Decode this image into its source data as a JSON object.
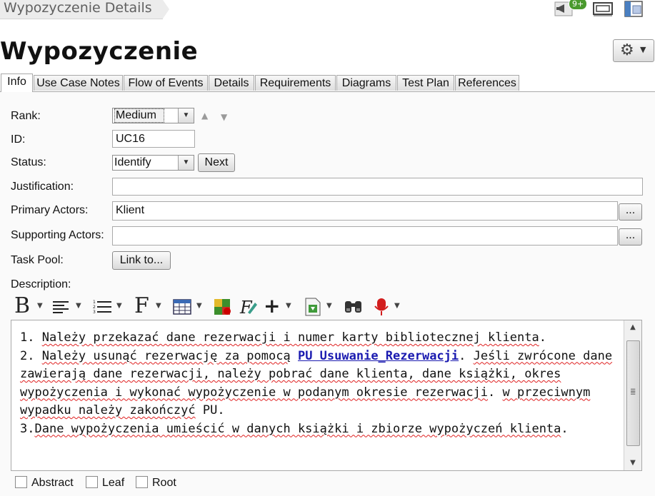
{
  "breadcrumb": "Wypozyczenie Details",
  "header": {
    "title": "Wypozyczenie",
    "notif_badge": "9+"
  },
  "tabs": [
    "Info",
    "Use Case Notes",
    "Flow of Events",
    "Details",
    "Requirements",
    "Diagrams",
    "Test Plan",
    "References"
  ],
  "active_tab": "Info",
  "form": {
    "rank_label": "Rank:",
    "rank_value": "Medium",
    "id_label": "ID:",
    "id_value": "UC16",
    "status_label": "Status:",
    "status_value": "Identify",
    "next_label": "Next",
    "justification_label": "Justification:",
    "justification_value": "",
    "primary_label": "Primary Actors:",
    "primary_value": "Klient",
    "supporting_label": "Supporting Actors:",
    "supporting_value": "",
    "ellipsis": "...",
    "taskpool_label": "Task Pool:",
    "link_label": "Link to...",
    "description_label": "Description:"
  },
  "description": {
    "l1a": "1. ",
    "l1b": "Należy przekazać dane rezerwacji i numer karty bibliotecznej klienta",
    "l1c": ".",
    "l2a": "2. ",
    "l2b": "Należy usunąć rezerwację za pomocą",
    "l2c": " ",
    "l2link": "PU Usuwanie_Rezerwacji",
    "l2d": ". ",
    "l2e": "Jeśli zwrócone dane zawierają dane rezerwacji, należy pobrać dane klienta, dane książki, okres wypożyczenia i wykonać wypożyczenie w podanym okresie rezerwacji",
    "l2f": ". ",
    "l2g": "w przeciwnym wypadku należy zakończyć",
    "l2h": " PU.",
    "l3a": "3.",
    "l3b": "Dane wypożyczenia umieścić w danych książki i zbiorze wypożyczeń klienta",
    "l3c": "."
  },
  "checkboxes": [
    "Abstract",
    "Leaf",
    "Root"
  ],
  "colors": {
    "badge": "#4a9a2e",
    "link": "#1a1ab0",
    "spell": "#e02020"
  },
  "toolbar_icons": [
    "bold-icon",
    "align-icon",
    "list-icon",
    "font-icon",
    "table-icon",
    "color-icon",
    "style-icon",
    "insert-icon",
    "import-icon",
    "find-icon",
    "spellcheck-icon"
  ]
}
